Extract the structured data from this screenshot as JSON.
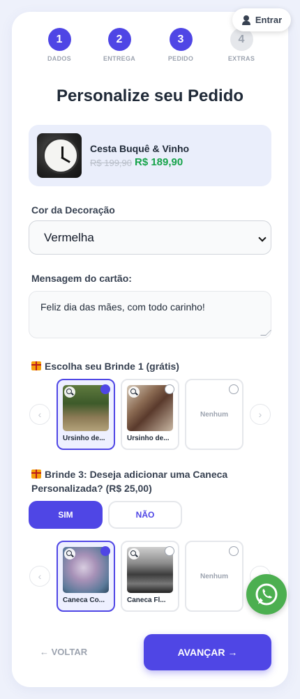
{
  "header": {
    "login_label": "Entrar"
  },
  "steps": [
    {
      "number": "1",
      "label": "DADOS",
      "active": true
    },
    {
      "number": "2",
      "label": "ENTREGA",
      "active": true
    },
    {
      "number": "3",
      "label": "PEDIDO",
      "active": true
    },
    {
      "number": "4",
      "label": "EXTRAS",
      "active": false
    }
  ],
  "page_title": "Personalize seu Pedido",
  "product": {
    "name": "Cesta Buquê & Vinho",
    "old_price": "R$ 199,90",
    "new_price": "R$ 189,90",
    "image_icon": "clock-image"
  },
  "decoration": {
    "label": "Cor da Decoração",
    "selected": "Vermelha"
  },
  "card_message": {
    "label": "Mensagem do cartão:",
    "value": "Feliz dia das mães, com todo carinho!"
  },
  "gift1": {
    "title": "Escolha seu Brinde 1 (grátis)",
    "options": [
      {
        "name": "Ursinho de...",
        "selected": true
      },
      {
        "name": "Ursinho de...",
        "selected": false
      },
      {
        "name": "Nenhum",
        "selected": false
      }
    ]
  },
  "gift3": {
    "title": "Brinde 3: Deseja adicionar uma Caneca Personalizada? (R$ 25,00)",
    "yes_label": "SIM",
    "no_label": "NÃO",
    "yes_selected": true,
    "options": [
      {
        "name": "Caneca Co...",
        "selected": true
      },
      {
        "name": "Caneca Fl...",
        "selected": false
      },
      {
        "name": "Nenhum",
        "selected": false
      }
    ]
  },
  "nav": {
    "back_label": "← VOLTAR",
    "next_label": "AVANÇAR →"
  },
  "colors": {
    "accent": "#4f46e5",
    "price_green": "#16a34a",
    "whatsapp": "#4caf50"
  }
}
